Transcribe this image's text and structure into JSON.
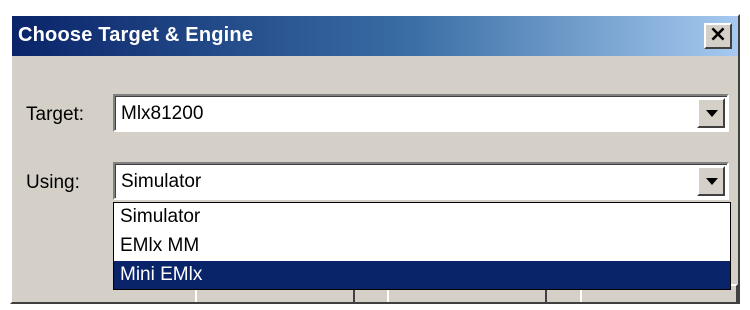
{
  "window": {
    "title": "Choose Target & Engine",
    "close_glyph": "×"
  },
  "target": {
    "label": "Target:",
    "value": "Mlx81200"
  },
  "using": {
    "label": "Using:",
    "value": "Simulator",
    "options": [
      "Simulator",
      "EMlx MM",
      "Mini EMlx"
    ],
    "highlighted_option": "Mini EMlx"
  },
  "colors": {
    "titlebar_start": "#0a246a",
    "titlebar_end": "#a6caf0",
    "selection": "#0a246a",
    "dialog_face": "#d4d0c8"
  }
}
